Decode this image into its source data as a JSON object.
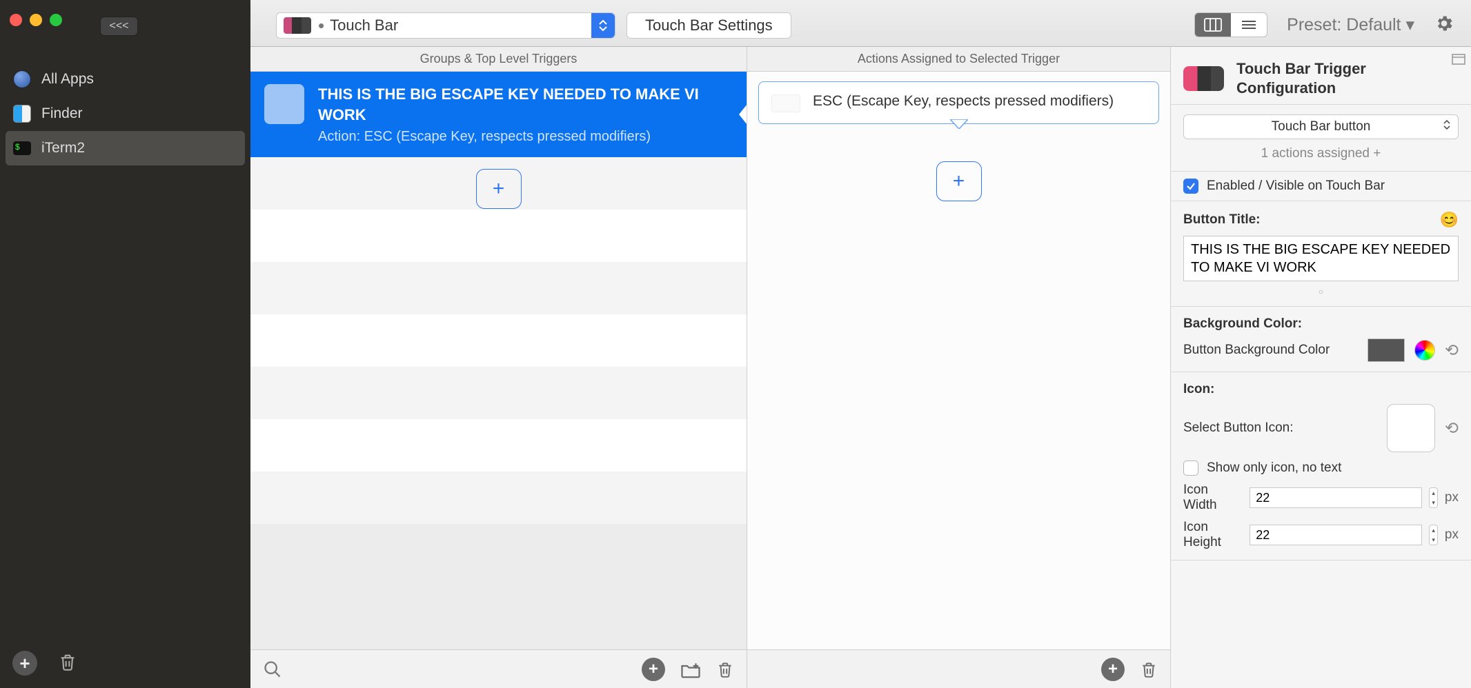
{
  "titlebar": {
    "collapse_label": "<<<",
    "combo_label": "Touch Bar",
    "settings_button": "Touch Bar Settings",
    "preset_label": "Preset: Default ▾"
  },
  "sidebar": {
    "items": [
      {
        "label": "All Apps"
      },
      {
        "label": "Finder"
      },
      {
        "label": "iTerm2"
      }
    ]
  },
  "triggers": {
    "header": "Groups & Top Level Triggers",
    "row": {
      "title": "THIS IS THE BIG ESCAPE KEY NEEDED TO MAKE VI WORK",
      "action": "Action: ESC (Escape Key, respects pressed modifiers)"
    }
  },
  "actions": {
    "header": "Actions Assigned to Selected Trigger",
    "item": "ESC (Escape Key, respects pressed modifiers)"
  },
  "config": {
    "title": "Touch Bar Trigger Configuration",
    "type_select": "Touch Bar button",
    "actions_assigned": "1 actions assigned +",
    "enabled_label": "Enabled / Visible on Touch Bar",
    "button_title_label": "Button Title:",
    "button_title_value": "THIS IS THE BIG ESCAPE KEY NEEDED TO MAKE VI WORK",
    "bg_label": "Background Color:",
    "bg_sub": "Button Background Color",
    "icon_label": "Icon:",
    "icon_sub": "Select Button Icon:",
    "show_icon_only": "Show only icon, no text",
    "icon_width_label": "Icon Width",
    "icon_width_value": "22",
    "icon_height_label": "Icon Height",
    "icon_height_value": "22",
    "px": "px"
  }
}
